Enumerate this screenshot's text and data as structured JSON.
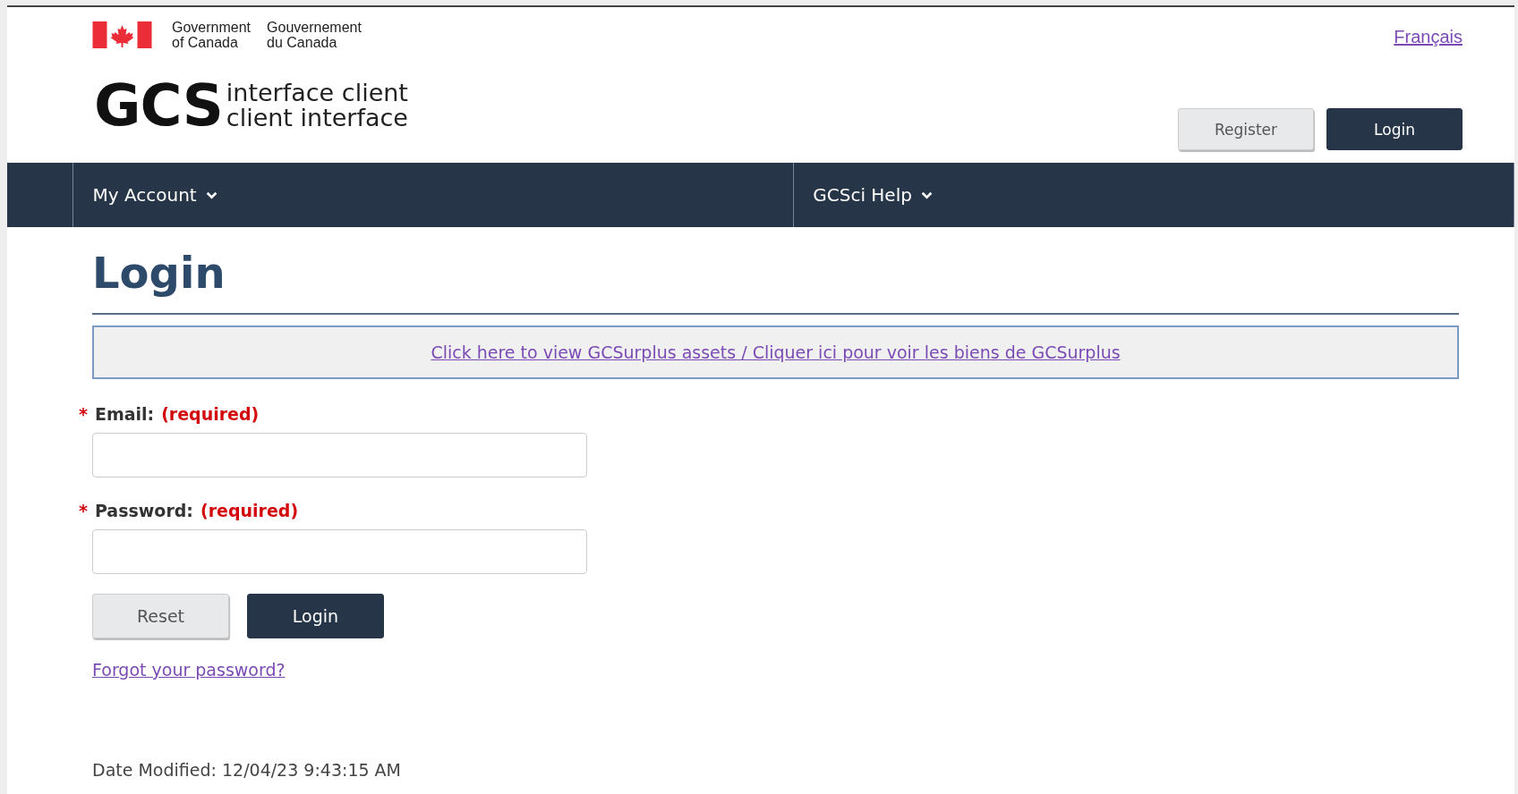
{
  "header": {
    "government_en": [
      "Government",
      "of Canada"
    ],
    "government_fr": [
      "Gouvernement",
      "du Canada"
    ],
    "language_link": "Français",
    "logo": {
      "mark": "GCS",
      "line_1": "interface client",
      "line_2": "client interface"
    },
    "buttons": [
      {
        "label": "Register",
        "kind": "secondary"
      },
      {
        "label": "Login",
        "kind": "primary"
      }
    ]
  },
  "nav": {
    "items": [
      {
        "label": "My Account",
        "expanded": false
      },
      {
        "label": "GCSci Help",
        "expanded": false
      }
    ]
  },
  "page": {
    "title": "Login",
    "banner_link": "Click here to view GCSurplus assets / Cliquer ici pour voir les biens de GCSurplus",
    "fields": [
      {
        "marker": "*",
        "label": "Email:",
        "note": "(required)"
      },
      {
        "marker": "*",
        "label": "Password:",
        "note": "(required)"
      }
    ],
    "buttons": [
      {
        "label": "Reset",
        "kind": "secondary"
      },
      {
        "label": "Login",
        "kind": "primary"
      }
    ],
    "forgot_link": "Forgot your password?",
    "date_modified": "Date Modified: 12/04/23 9:43:15 AM"
  }
}
